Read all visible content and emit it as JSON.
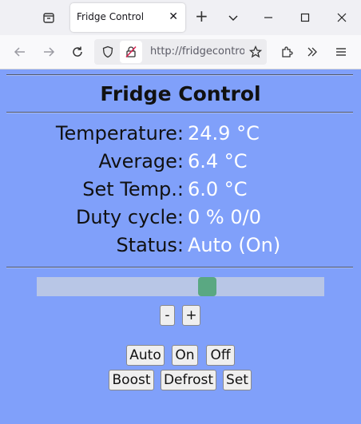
{
  "browser": {
    "tab_title": "Fridge Control",
    "url": "http://fridgecontrol",
    "tab_close_glyph": "✕",
    "new_tab_glyph": "+"
  },
  "page": {
    "title": "Fridge Control",
    "rows": [
      {
        "label": "Temperature:",
        "value": "24.9 °C"
      },
      {
        "label": "Average:",
        "value": "6.4 °C"
      },
      {
        "label": "Set Temp.:",
        "value": "6.0 °C"
      },
      {
        "label": "Duty cycle:",
        "value": "0 % 0/0"
      },
      {
        "label": "Status:",
        "value": "Auto (On)"
      }
    ],
    "slider": {
      "position_fraction": 0.6
    },
    "buttons": {
      "minus": "-",
      "plus": "+",
      "auto": "Auto",
      "on": "On",
      "off": "Off",
      "boost": "Boost",
      "defrost": "Defrost",
      "set": "Set"
    }
  },
  "colors": {
    "page_background": "#80a0fa",
    "value_text": "#ffffff",
    "slider_thumb": "#5aa882"
  }
}
